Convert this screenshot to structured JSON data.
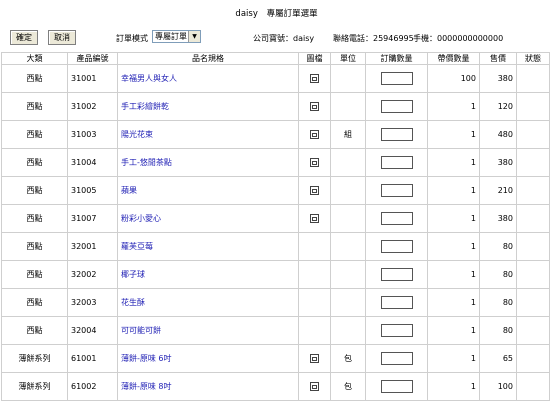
{
  "header": {
    "user": "daisy",
    "title": "專屬訂單選單"
  },
  "toolbar": {
    "confirm_label": "確定",
    "cancel_label": "取消",
    "mode_label": "訂單模式",
    "mode_value": "專屬訂單",
    "company_label": "公司寶號：daisy",
    "phone_label": "聯絡電話：25946995",
    "mobile_label": "手機：0000000000000"
  },
  "columns": [
    "大類",
    "產品編號",
    "品名規格",
    "圖檔",
    "單位",
    "訂購數量",
    "帶價數量",
    "售價",
    "狀態"
  ],
  "icons": {
    "picture": "picture-icon",
    "dropdown": "chevron-down-icon"
  },
  "rows": [
    {
      "category": "西點",
      "code": "31001",
      "name": "幸福男人與女人",
      "has_pic": true,
      "unit": "",
      "qty": "",
      "price_qty": "100",
      "price": "380",
      "status": ""
    },
    {
      "category": "西點",
      "code": "31002",
      "name": "手工彩繪餅乾",
      "has_pic": true,
      "unit": "",
      "qty": "",
      "price_qty": "1",
      "price": "120",
      "status": ""
    },
    {
      "category": "西點",
      "code": "31003",
      "name": "陽光花束",
      "has_pic": true,
      "unit": "組",
      "qty": "",
      "price_qty": "1",
      "price": "480",
      "status": ""
    },
    {
      "category": "西點",
      "code": "31004",
      "name": "手工-悠閒茶點",
      "has_pic": true,
      "unit": "",
      "qty": "",
      "price_qty": "1",
      "price": "380",
      "status": ""
    },
    {
      "category": "西點",
      "code": "31005",
      "name": "蘋果",
      "has_pic": true,
      "unit": "",
      "qty": "",
      "price_qty": "1",
      "price": "210",
      "status": ""
    },
    {
      "category": "西點",
      "code": "31007",
      "name": "粉彩小愛心",
      "has_pic": true,
      "unit": "",
      "qty": "",
      "price_qty": "1",
      "price": "380",
      "status": ""
    },
    {
      "category": "西點",
      "code": "32001",
      "name": "蘿芙亞莓",
      "has_pic": false,
      "unit": "",
      "qty": "",
      "price_qty": "1",
      "price": "80",
      "status": ""
    },
    {
      "category": "西點",
      "code": "32002",
      "name": "椰子球",
      "has_pic": false,
      "unit": "",
      "qty": "",
      "price_qty": "1",
      "price": "80",
      "status": ""
    },
    {
      "category": "西點",
      "code": "32003",
      "name": "花生酥",
      "has_pic": false,
      "unit": "",
      "qty": "",
      "price_qty": "1",
      "price": "80",
      "status": ""
    },
    {
      "category": "西點",
      "code": "32004",
      "name": "可可能可餅",
      "has_pic": false,
      "unit": "",
      "qty": "",
      "price_qty": "1",
      "price": "80",
      "status": ""
    },
    {
      "category": "薄餅系列",
      "code": "61001",
      "name": "薄餅-原味 6吋",
      "has_pic": true,
      "unit": "包",
      "qty": "",
      "price_qty": "1",
      "price": "65",
      "status": ""
    },
    {
      "category": "薄餅系列",
      "code": "61002",
      "name": "薄餅-原味 8吋",
      "has_pic": true,
      "unit": "包",
      "qty": "",
      "price_qty": "1",
      "price": "100",
      "status": ""
    }
  ]
}
